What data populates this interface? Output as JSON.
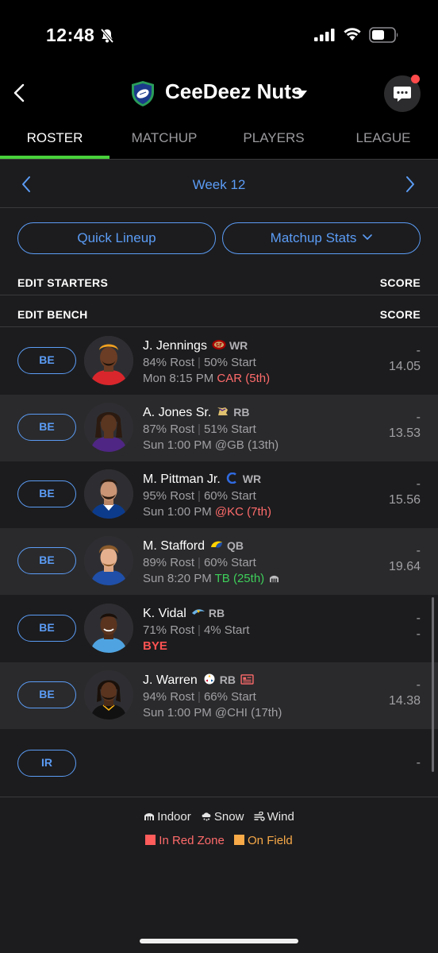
{
  "status": {
    "time": "12:48"
  },
  "header": {
    "team_name": "CeeDeez Nuts"
  },
  "tabs": [
    {
      "label": "ROSTER",
      "active": true
    },
    {
      "label": "MATCHUP"
    },
    {
      "label": "PLAYERS"
    },
    {
      "label": "LEAGUE"
    }
  ],
  "week": {
    "label": "Week 12"
  },
  "buttons": {
    "quick_lineup": "Quick Lineup",
    "matchup_stats": "Matchup Stats"
  },
  "sections": {
    "starters": "EDIT STARTERS",
    "starters_score": "SCORE",
    "bench": "EDIT BENCH",
    "bench_score": "SCORE"
  },
  "players": [
    {
      "slot": "BE",
      "name": "J. Jennings",
      "pos": "WR",
      "rost": "84% Rost",
      "start": "50% Start",
      "game_time": "Mon 8:15 PM",
      "opp": "CAR",
      "rank": "(5th)",
      "score_top": "-",
      "projected": "14.05"
    },
    {
      "slot": "BE",
      "name": "A. Jones Sr.",
      "pos": "RB",
      "rost": "87% Rost",
      "start": "51% Start",
      "game_time": "Sun 1:00 PM",
      "opp": "@GB",
      "rank": "(13th)",
      "score_top": "-",
      "projected": "13.53"
    },
    {
      "slot": "BE",
      "name": "M. Pittman Jr.",
      "pos": "WR",
      "rost": "95% Rost",
      "start": "60% Start",
      "game_time": "Sun 1:00 PM",
      "opp": "@KC",
      "rank": "(7th)",
      "score_top": "-",
      "projected": "15.56"
    },
    {
      "slot": "BE",
      "name": "M. Stafford",
      "pos": "QB",
      "rost": "89% Rost",
      "start": "60% Start",
      "game_time": "Sun 8:20 PM",
      "opp": "TB",
      "rank": "(25th)",
      "score_top": "-",
      "projected": "19.64"
    },
    {
      "slot": "BE",
      "name": "K. Vidal",
      "pos": "RB",
      "rost": "71% Rost",
      "start": "4% Start",
      "game_time": "BYE",
      "score_top": "-",
      "projected": "-"
    },
    {
      "slot": "BE",
      "name": "J. Warren",
      "pos": "RB",
      "rost": "94% Rost",
      "start": "66% Start",
      "game_time": "Sun 1:00 PM",
      "opp": "@CHI",
      "rank": "(17th)",
      "score_top": "-",
      "projected": "14.38"
    }
  ],
  "ir": {
    "slot": "IR",
    "score": "-"
  },
  "legend": {
    "indoor": "Indoor",
    "snow": "Snow",
    "wind": "Wind",
    "red_zone": "In Red Zone",
    "on_field": "On Field"
  },
  "colors": {
    "accent": "#5b9cf5",
    "active_tab": "#48d13a",
    "red": "#ff6b6b",
    "green": "#3ecf5a",
    "orange": "#f8a948"
  },
  "icons": [
    "bell-slash-icon",
    "signal-icon",
    "wifi-icon",
    "battery-icon",
    "back-chevron-icon",
    "team-shield-icon",
    "caret-down-icon",
    "chat-icon",
    "chevron-left-icon",
    "chevron-right-icon",
    "stadium-icon",
    "snow-icon",
    "wind-icon",
    "injury-report-icon"
  ]
}
